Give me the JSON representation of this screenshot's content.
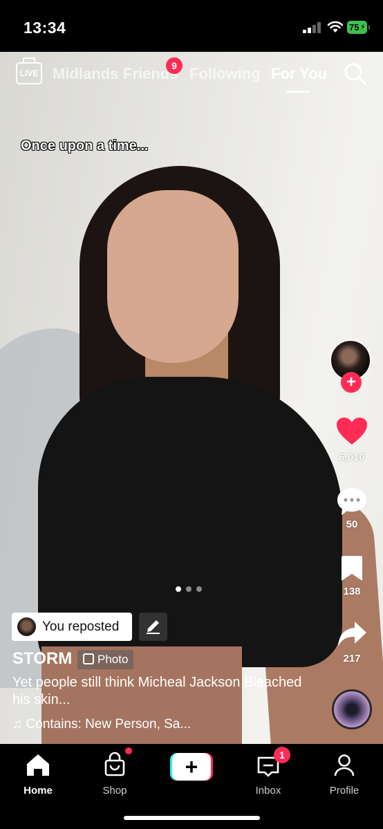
{
  "status_bar": {
    "time": "13:34",
    "battery": "75"
  },
  "top_nav": {
    "tabs": [
      {
        "label": "Midlands"
      },
      {
        "label": "Friends",
        "badge": "9"
      },
      {
        "label": "Following"
      },
      {
        "label": "For You",
        "active": true
      }
    ],
    "live_label": "LIVE"
  },
  "post": {
    "overlay_text": "Once upon a time...",
    "reposted_label": "You reposted",
    "username": "STORM",
    "type_tag": "Photo",
    "description": "Yet people still think Micheal Jackson Bleached his skin...",
    "music": "Contains: New Person, Sa...",
    "likes": "6,010",
    "comments": "50",
    "saves": "138",
    "shares": "217",
    "photo_index": 1,
    "photo_count": 3
  },
  "bottom_nav": {
    "home": "Home",
    "shop": "Shop",
    "inbox": "Inbox",
    "inbox_badge": "1",
    "profile": "Profile"
  },
  "colors": {
    "accent": "#fe2c55",
    "cyan": "#25f4ee",
    "battery": "#3ec24f"
  }
}
